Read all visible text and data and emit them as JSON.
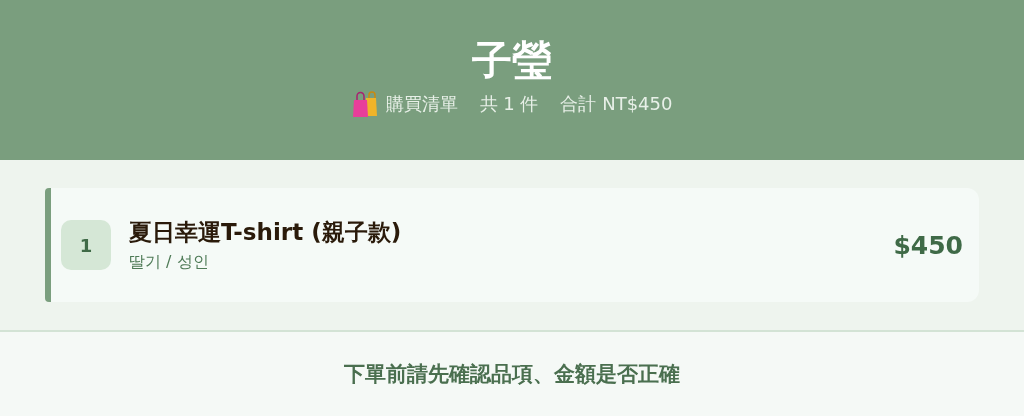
{
  "header": {
    "title": "子瑩",
    "subtitle": [
      "購買清單",
      "共 1 件",
      "合計 NT$450"
    ]
  },
  "items": [
    {
      "index": "1",
      "name": "夏日幸運T-shirt (親子款)",
      "variant": "딸기 / 성인",
      "price": "$450"
    }
  ],
  "footer": {
    "note": "下單前請先確認品項、金額是否正確"
  }
}
